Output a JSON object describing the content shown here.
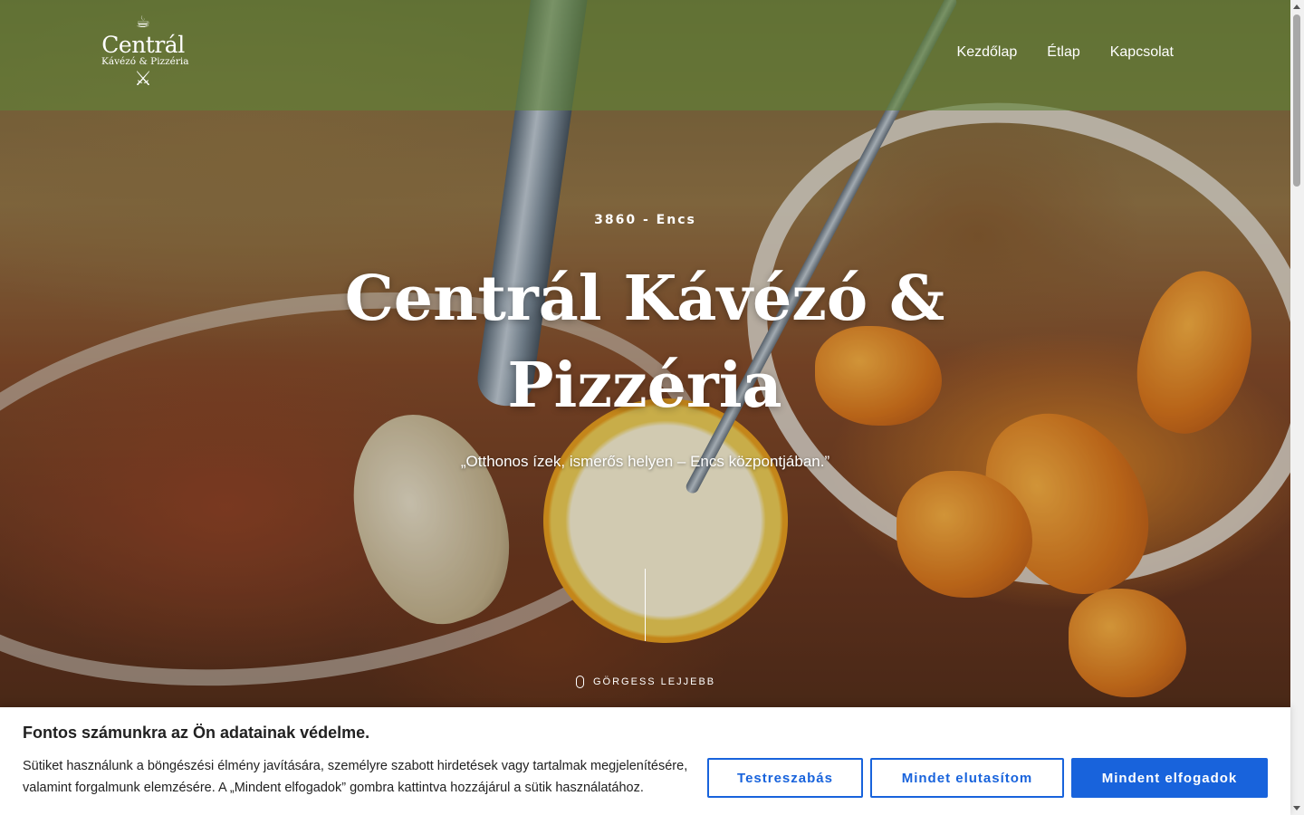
{
  "header": {
    "logo": {
      "name": "Centrál",
      "subtitle": "Kávézó & Pizzéria",
      "cup_icon": "☕",
      "cutlery_icon": "⚔"
    },
    "nav": [
      {
        "label": "Kezdőlap"
      },
      {
        "label": "Étlap"
      },
      {
        "label": "Kapcsolat"
      }
    ]
  },
  "hero": {
    "eyebrow": "3860 - Encs",
    "title": "Centrál Kávézó & Pizzéria",
    "tagline": "„Otthonos ízek, ismerős helyen – Encs központjában.”",
    "scroll_hint": "GÖRGESS LEJJEBB"
  },
  "cookie_banner": {
    "title": "Fontos számunkra az Ön adatainak védelme.",
    "text": "Sütiket használunk a böngészési élmény javítására, személyre szabott hirdetések vagy tartalmak megjelenítésére, valamint forgalmunk elemzésére. A „Mindent elfogadok” gombra kattintva hozzájárul a sütik használatához.",
    "buttons": {
      "customize": "Testreszabás",
      "reject": "Mindet elutasítom",
      "accept": "Mindent elfogadok"
    },
    "colors": {
      "accent": "#1863dc"
    }
  },
  "colors": {
    "header_overlay": "#5f8237"
  }
}
